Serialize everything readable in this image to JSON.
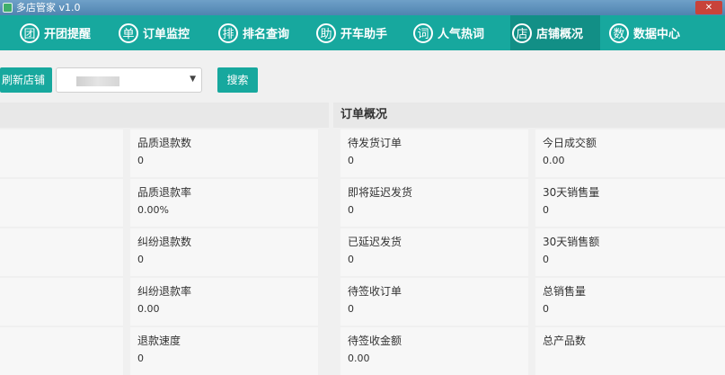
{
  "window": {
    "title": "多店管家 v1.0",
    "close_glyph": "✕"
  },
  "nav": {
    "items": [
      {
        "icon_char": "团",
        "label": "开团提醒",
        "icon": "tuan-circle-icon"
      },
      {
        "icon_char": "单",
        "label": "订单监控",
        "icon": "dan-circle-icon"
      },
      {
        "icon_char": "排",
        "label": "排名查询",
        "icon": "pai-circle-icon"
      },
      {
        "icon_char": "助",
        "label": "开车助手",
        "icon": "zhu-circle-icon"
      },
      {
        "icon_char": "词",
        "label": "人气热词",
        "icon": "ci-circle-icon"
      },
      {
        "icon_char": "店",
        "label": "店铺概况",
        "icon": "dian-circle-icon",
        "active": true
      },
      {
        "icon_char": "数",
        "label": "数据中心",
        "icon": "shu-circle-icon"
      }
    ]
  },
  "toolbar": {
    "refresh_label": "刷新店铺",
    "shop_select_arrow": "▼",
    "search_label": "搜索"
  },
  "left_panel": {
    "header": "",
    "rows": [
      {
        "label": "品质退款数",
        "value": "0"
      },
      {
        "label": "品质退款率",
        "value": "0.00%"
      },
      {
        "label": "纠纷退款数",
        "value": "0"
      },
      {
        "label": "纠纷退款率",
        "value": "0.00"
      },
      {
        "label": "退款速度",
        "value": "0"
      }
    ]
  },
  "order_panel": {
    "header": "订单概况",
    "left_col": [
      {
        "label": "待发货订单",
        "value": "0"
      },
      {
        "label": "即将延迟发货",
        "value": "0"
      },
      {
        "label": "已延迟发货",
        "value": "0"
      },
      {
        "label": "待签收订单",
        "value": "0"
      },
      {
        "label": "待签收金额",
        "value": "0.00"
      }
    ],
    "right_col": [
      {
        "label": "今日成交额",
        "value": "0.00"
      },
      {
        "label": "30天销售量",
        "value": "0"
      },
      {
        "label": "30天销售额",
        "value": "0"
      },
      {
        "label": "总销售量",
        "value": "0"
      },
      {
        "label": "总产品数",
        "value": ""
      }
    ]
  },
  "colors": {
    "nav_bg": "#17a89e",
    "nav_active": "#128f86",
    "button": "#17a89e"
  }
}
